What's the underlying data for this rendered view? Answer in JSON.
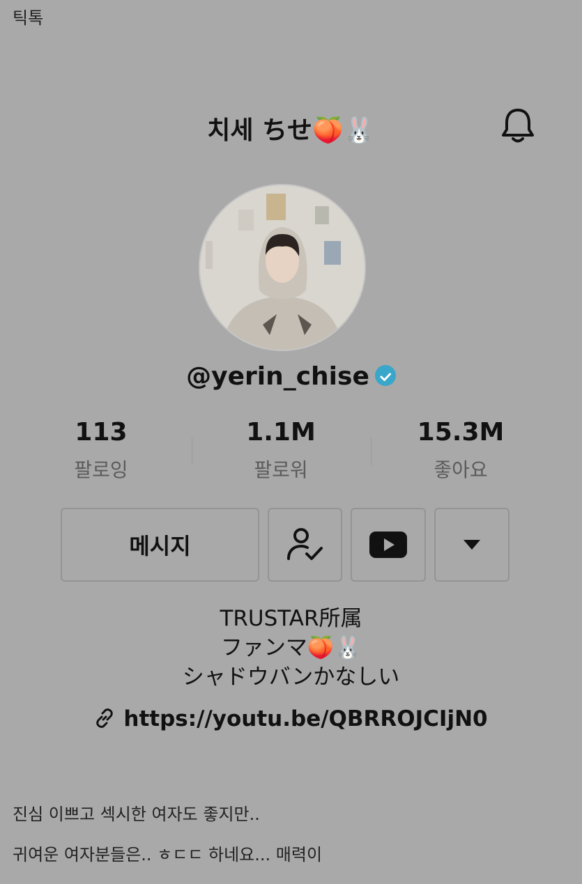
{
  "top_label": "틱톡",
  "header": {
    "title": "치세 ちせ",
    "title_emoji": "🍑🐰"
  },
  "profile": {
    "username": "@yerin_chise",
    "verified": true
  },
  "stats": [
    {
      "value": "113",
      "label": "팔로잉"
    },
    {
      "value": "1.1M",
      "label": "팔로워"
    },
    {
      "value": "15.3M",
      "label": "좋아요"
    }
  ],
  "actions": {
    "message_label": "메시지"
  },
  "bio": {
    "line1": "TRUSTAR所属",
    "line2": "ファンマ🍑🐰",
    "line3": "シャドウバンかなしい",
    "link": "https://youtu.be/QBRROJCIjN0"
  },
  "caption": {
    "line1": "진심 이쁘고 섹시한 여자도 좋지만..",
    "line2": "귀여운 여자분들은.. ㅎㄷㄷ 하네요...  매력이"
  },
  "colors": {
    "background": "#a9a9a9",
    "verified": "#3aa6c9",
    "text": "#111111"
  },
  "icons": [
    "bell-icon",
    "verified-badge-icon",
    "follow-check-icon",
    "youtube-icon",
    "dropdown-arrow-icon",
    "link-icon"
  ]
}
